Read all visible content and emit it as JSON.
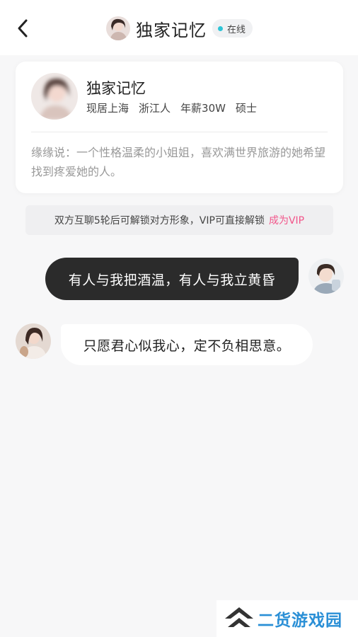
{
  "header": {
    "title": "独家记忆",
    "status": "在线",
    "icons": {
      "back": "chevron-left-icon",
      "status_dot": "online-dot-icon"
    }
  },
  "profile": {
    "name": "独家记忆",
    "meta": [
      "现居上海",
      "浙江人",
      "年薪30W",
      "硕士"
    ],
    "intro": "缘缘说：一个性格温柔的小姐姐，喜欢满世界旅游的她希望找到疼爱她的人。"
  },
  "notice": {
    "text": "双方互聊5轮后可解锁对方形象，VIP可直接解锁",
    "link": "成为VIP"
  },
  "messages": [
    {
      "from": "me",
      "text": "有人与我把酒温，有人与我立黄昏"
    },
    {
      "from": "her",
      "text": "只愿君心似我心，定不负相思意。"
    }
  ],
  "watermark": {
    "text": "二货游戏园"
  },
  "colors": {
    "accent_pink": "#f2558a",
    "online_dot": "#2ec4d6",
    "outgoing_bubble": "#2b2b2b",
    "watermark_blue": "#2a8fd6"
  }
}
